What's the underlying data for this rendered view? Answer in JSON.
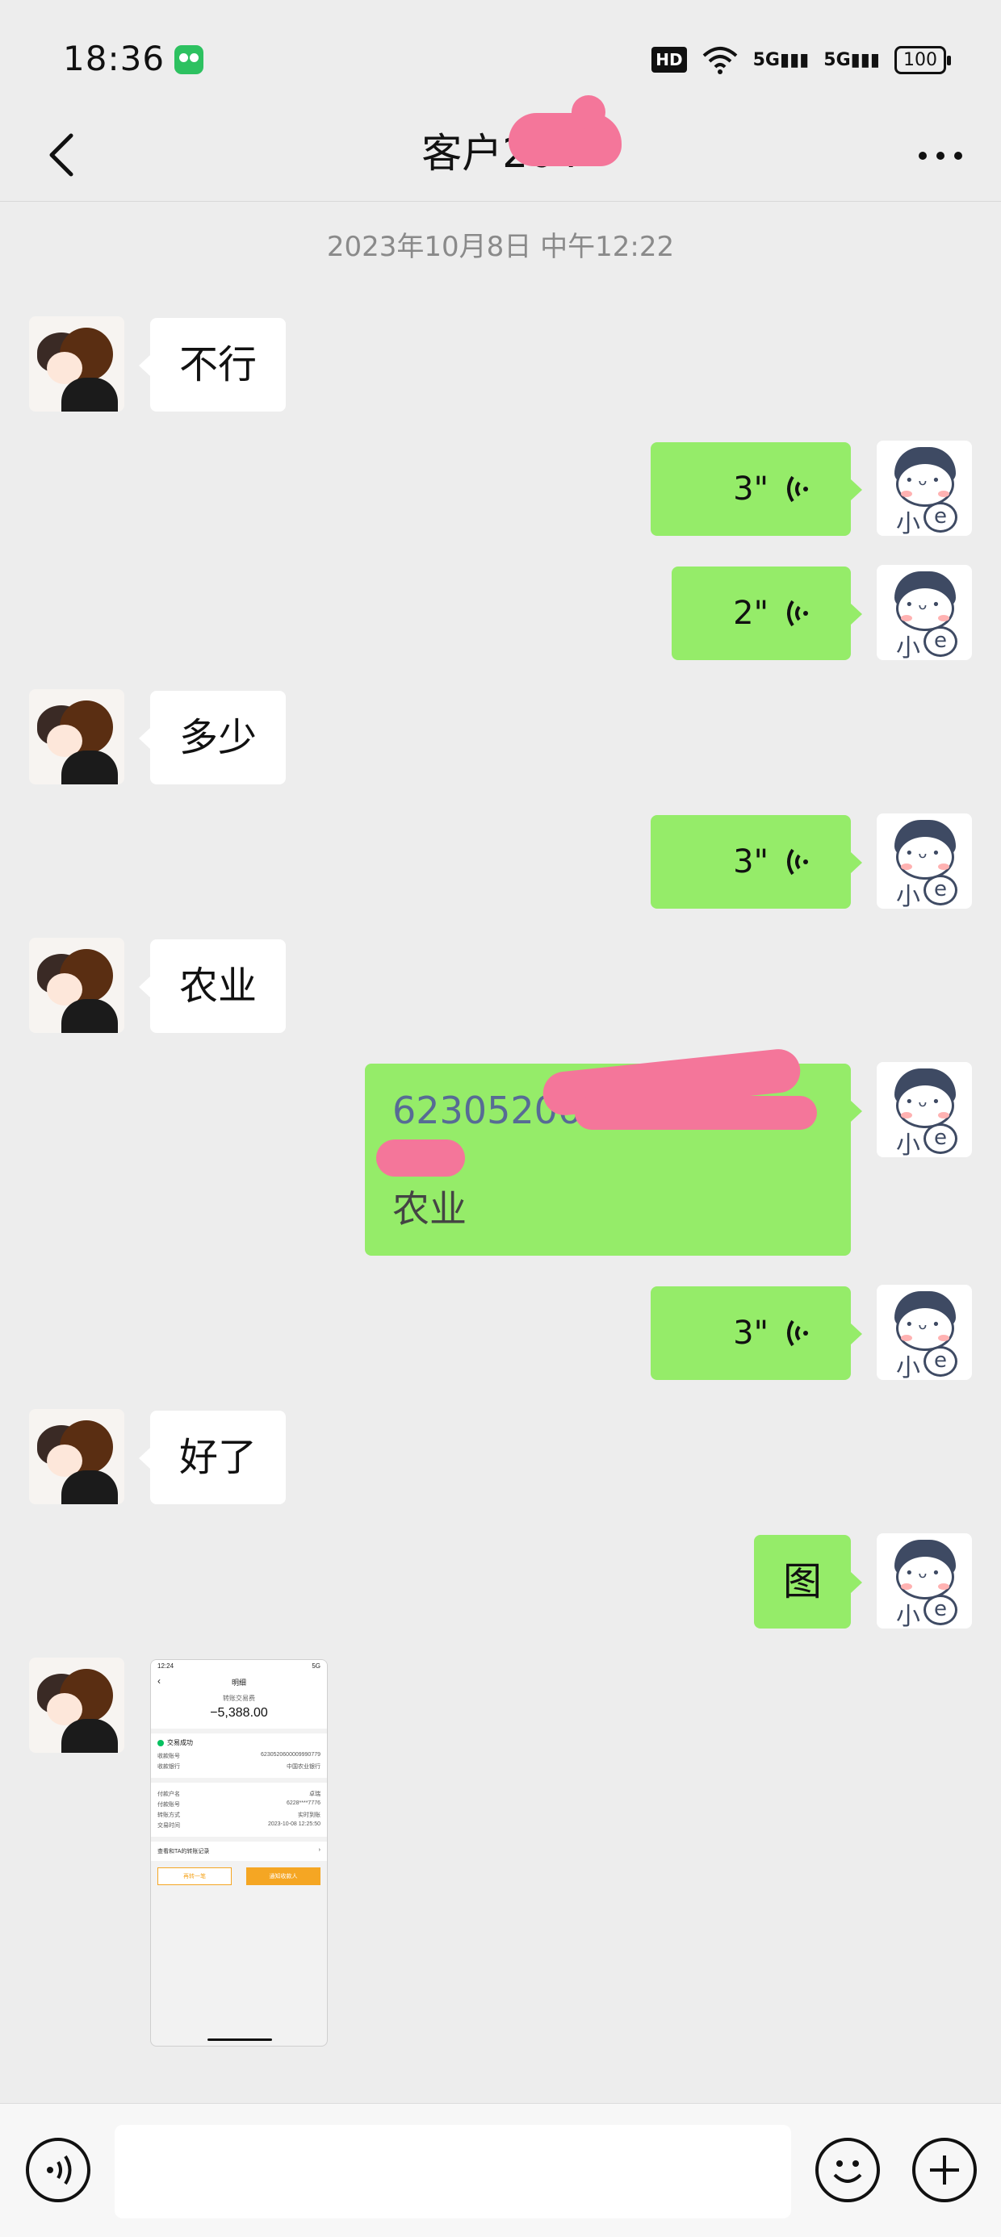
{
  "status_bar": {
    "time": "18:36",
    "hd": "HD",
    "signal1": "5G",
    "signal2": "5G",
    "battery": "100"
  },
  "header": {
    "title": "客户264",
    "back_icon": "chevron-left-icon",
    "more_icon": "more-dots-icon"
  },
  "chat": {
    "timestamp": "2023年10月8日 中午12:22",
    "messages": [
      {
        "side": "left",
        "type": "text",
        "text": "不行"
      },
      {
        "side": "right",
        "type": "voice",
        "duration": "3\""
      },
      {
        "side": "right",
        "type": "voice",
        "duration": "2\""
      },
      {
        "side": "left",
        "type": "text",
        "text": "多少"
      },
      {
        "side": "right",
        "type": "voice",
        "duration": "3\""
      },
      {
        "side": "left",
        "type": "text",
        "text": "农业"
      },
      {
        "side": "right",
        "type": "text",
        "lines": [
          "62305206000",
          "吴",
          "农业"
        ]
      },
      {
        "side": "right",
        "type": "voice",
        "duration": "3\""
      },
      {
        "side": "left",
        "type": "text",
        "text": "好了"
      },
      {
        "side": "right",
        "type": "text",
        "text": "图"
      },
      {
        "side": "left",
        "type": "image"
      }
    ],
    "right_avatar_label": "小",
    "right_avatar_badge": "e"
  },
  "receipt": {
    "time": "12:24",
    "signal": "5G",
    "title": "明细",
    "label": "转账交易费",
    "amount": "−5,388.00",
    "status": "交易成功",
    "rows": [
      {
        "k": "收款账号",
        "v": "6230520600009990779"
      },
      {
        "k": "收款银行",
        "v": "中国农业银行"
      }
    ],
    "rows2": [
      {
        "k": "付款户名",
        "v": "卓瑞"
      },
      {
        "k": "付款账号",
        "v": "6228****7776"
      },
      {
        "k": "转账方式",
        "v": "实时到账"
      },
      {
        "k": "交易时间",
        "v": "2023-10-08 12:25:50"
      }
    ],
    "link": "查看和TA的转账记录",
    "link_arrow": "›",
    "btn1": "再转一笔",
    "btn2": "通知收款人"
  },
  "input_bar": {
    "voice_icon": "voice-input-icon",
    "emoji_icon": "emoji-icon",
    "plus_icon": "plus-icon"
  }
}
